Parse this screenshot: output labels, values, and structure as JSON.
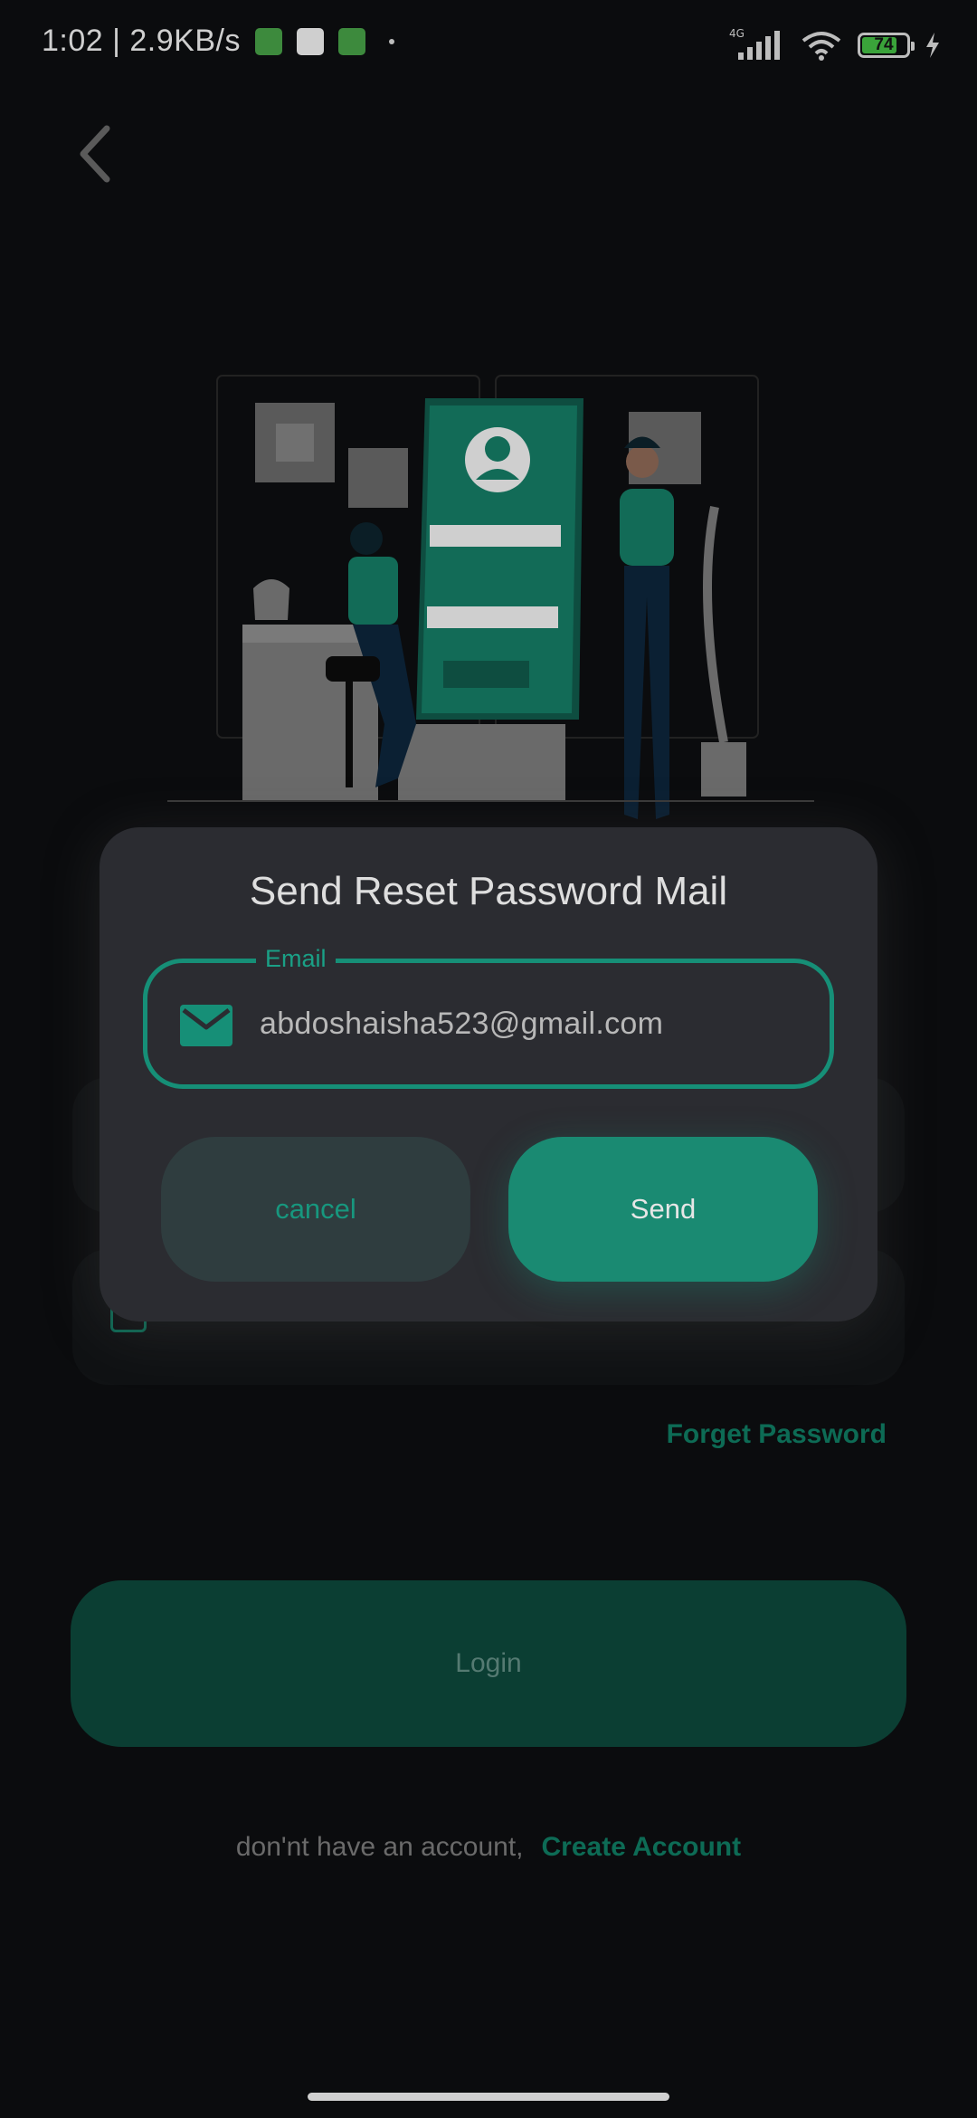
{
  "status_bar": {
    "time_speed": "1:02 | 2.9KB/s",
    "network": "4G",
    "battery": "74",
    "battery_level": 0.74,
    "colors": {
      "battery_fill": "#3aa33a",
      "notif_green": "#4caf50"
    }
  },
  "dialog": {
    "title": "Send Reset Password Mail",
    "email_label": "Email",
    "email_value": "abdoshaisha523@gmail.com",
    "cancel_label": "cancel",
    "send_label": "Send"
  },
  "background": {
    "forget_password": "Forget Password",
    "login_label": "Login",
    "no_account_text": "don'nt have an account,",
    "create_account": "Create Account"
  },
  "icons": [
    "back-arrow-icon",
    "mail-icon",
    "wifi-icon",
    "signal-icon",
    "battery-icon",
    "charging-icon"
  ],
  "colors": {
    "accent": "#1a8a72",
    "dialog_bg": "#2b2c31",
    "page_bg": "#0b0c0e"
  }
}
